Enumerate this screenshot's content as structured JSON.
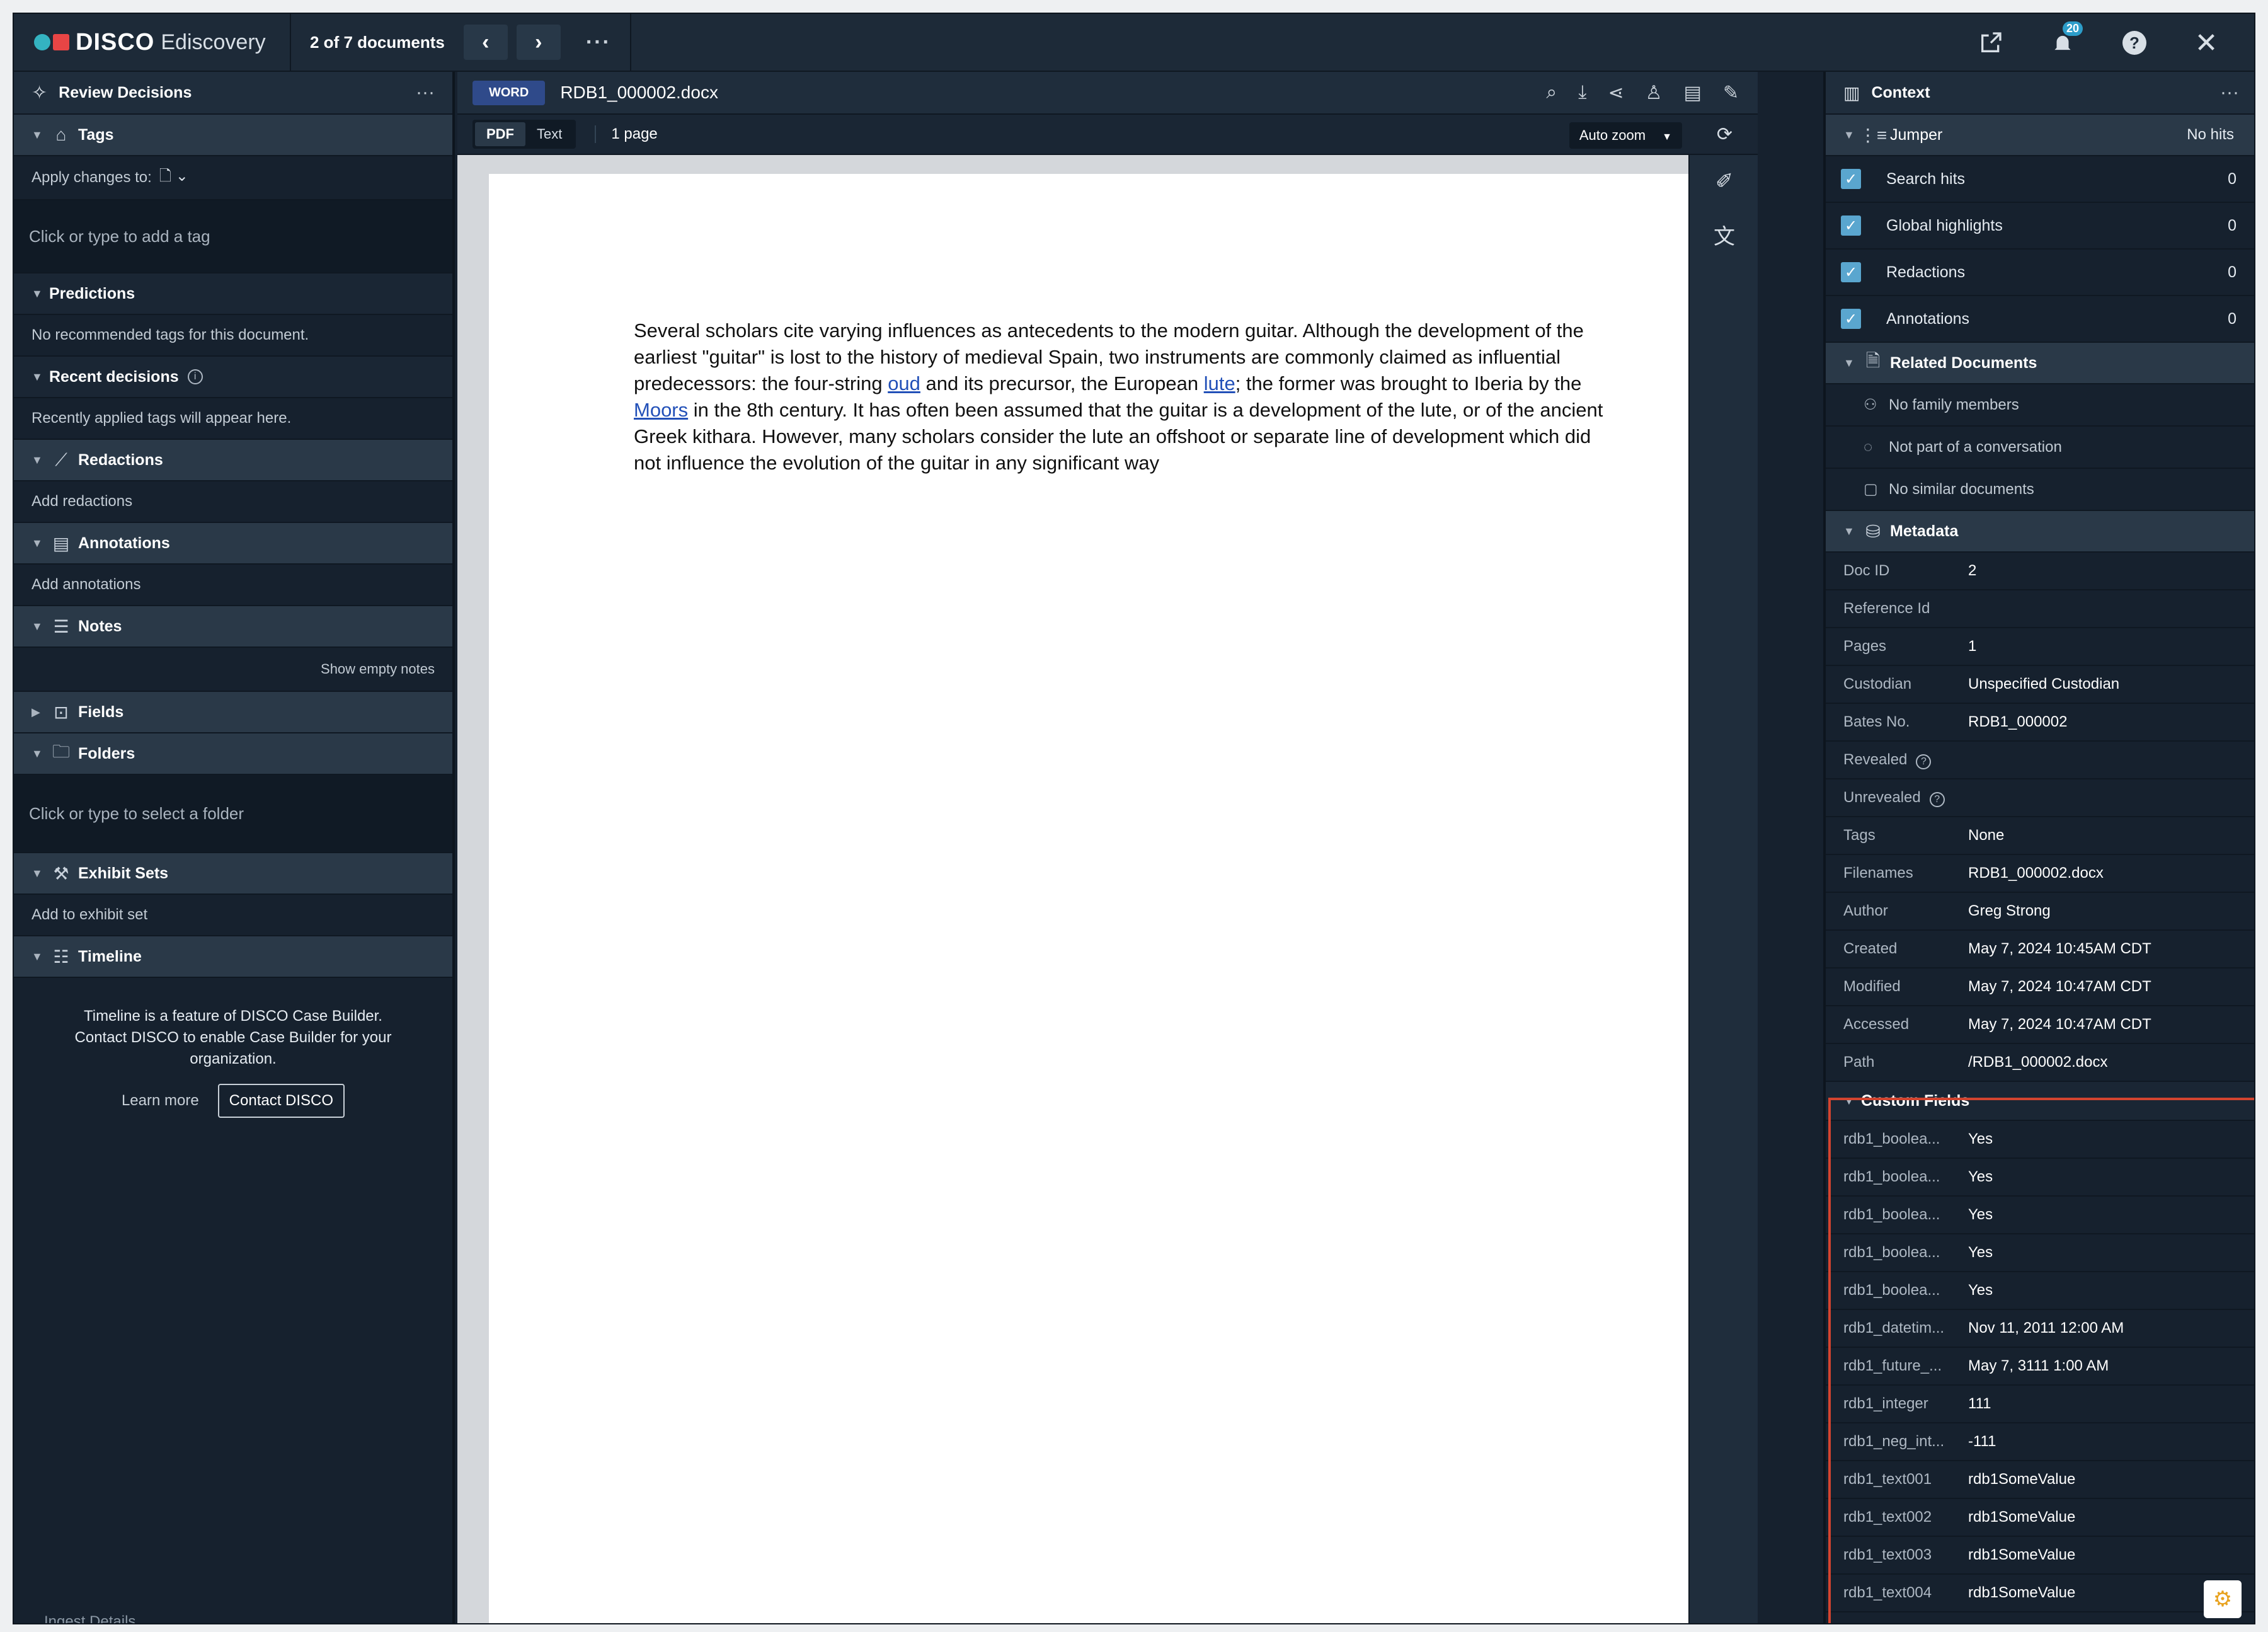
{
  "app": {
    "brand": "DISCO",
    "product": "Ediscovery",
    "doc_count": "2 of 7 documents",
    "notification_count": "20"
  },
  "left": {
    "header": "Review Decisions",
    "tags": {
      "label": "Tags",
      "apply_label": "Apply changes to:",
      "input_placeholder": "Click or type to add a tag"
    },
    "predictions": {
      "label": "Predictions",
      "text": "No recommended tags for this document."
    },
    "recent": {
      "label": "Recent decisions",
      "text": "Recently applied tags will appear here."
    },
    "redactions": {
      "label": "Redactions",
      "text": "Add redactions"
    },
    "annotations": {
      "label": "Annotations",
      "text": "Add annotations"
    },
    "notes": {
      "label": "Notes",
      "text": "Show empty notes"
    },
    "fields": {
      "label": "Fields"
    },
    "folders": {
      "label": "Folders",
      "input_placeholder": "Click or type to select a folder"
    },
    "exhibits": {
      "label": "Exhibit Sets",
      "text": "Add to exhibit set"
    },
    "timeline": {
      "label": "Timeline",
      "text": "Timeline is a feature of DISCO Case Builder. Contact DISCO to enable Case Builder for your organization.",
      "learn_more": "Learn more",
      "contact": "Contact DISCO"
    },
    "footer_text": "Ingest Details"
  },
  "viewer": {
    "badge": "WORD",
    "filename": "RDB1_000002.docx",
    "mode_pdf": "PDF",
    "mode_text": "Text",
    "page_count": "1 page",
    "zoom": "Auto zoom",
    "text_a": "Several scholars cite varying influences as antecedents to the modern guitar. Although the development of the earliest \"guitar\" is lost to the history of medieval Spain, two instruments are commonly claimed as influential predecessors: the four-string ",
    "link_oud": "oud",
    "text_b": " and its precursor, the European ",
    "link_lute": "lute",
    "text_c": "; the former was brought to Iberia by the ",
    "link_moors": "Moors",
    "text_d": " in the 8th century. It has often been assumed that the guitar is a development of the lute, or of the ancient Greek kithara. However, many scholars consider the lute an offshoot or separate line of development which did not influence the evolution of the guitar in any significant way"
  },
  "right": {
    "header": "Context",
    "jumper": {
      "label": "Jumper",
      "status": "No hits",
      "items": [
        {
          "label": "Search hits",
          "value": "0"
        },
        {
          "label": "Global highlights",
          "value": "0"
        },
        {
          "label": "Redactions",
          "value": "0"
        },
        {
          "label": "Annotations",
          "value": "0"
        }
      ]
    },
    "related": {
      "label": "Related Documents",
      "items": [
        "No family members",
        "Not part of a conversation",
        "No similar documents"
      ]
    },
    "metadata": {
      "label": "Metadata",
      "rows": [
        {
          "key": "Doc ID",
          "value": "2"
        },
        {
          "key": "Reference Id",
          "value": ""
        },
        {
          "key": "Pages",
          "value": "1"
        },
        {
          "key": "Custodian",
          "value": "Unspecified Custodian"
        },
        {
          "key": "Bates No.",
          "value": "RDB1_000002"
        },
        {
          "key": "Revealed",
          "value": ""
        },
        {
          "key": "Unrevealed",
          "value": ""
        },
        {
          "key": "Tags",
          "value": "None"
        },
        {
          "key": "Filenames",
          "value": "RDB1_000002.docx"
        },
        {
          "key": "Author",
          "value": "Greg Strong"
        },
        {
          "key": "Created",
          "value": "May 7, 2024 10:45AM CDT"
        },
        {
          "key": "Modified",
          "value": "May 7, 2024 10:47AM CDT"
        },
        {
          "key": "Accessed",
          "value": "May 7, 2024 10:47AM CDT"
        },
        {
          "key": "Path",
          "value": "/RDB1_000002.docx"
        }
      ]
    },
    "custom": {
      "label": "Custom Fields",
      "rows": [
        {
          "key": "rdb1_boolea...",
          "value": "Yes"
        },
        {
          "key": "rdb1_boolea...",
          "value": "Yes"
        },
        {
          "key": "rdb1_boolea...",
          "value": "Yes"
        },
        {
          "key": "rdb1_boolea...",
          "value": "Yes"
        },
        {
          "key": "rdb1_boolea...",
          "value": "Yes"
        },
        {
          "key": "rdb1_datetim...",
          "value": "Nov 11, 2011 12:00 AM"
        },
        {
          "key": "rdb1_future_...",
          "value": "May 7, 3111 1:00 AM"
        },
        {
          "key": "rdb1_integer",
          "value": "111"
        },
        {
          "key": "rdb1_neg_int...",
          "value": "-111"
        },
        {
          "key": "rdb1_text001",
          "value": "rdb1SomeValue"
        },
        {
          "key": "rdb1_text002",
          "value": "rdb1SomeValue"
        },
        {
          "key": "rdb1_text003",
          "value": "rdb1SomeValue"
        },
        {
          "key": "rdb1_text004",
          "value": "rdb1SomeValue"
        }
      ]
    }
  },
  "colors": {
    "accent": "#5aa6cf",
    "highlight_border": "#d3442f",
    "link": "#2250b8"
  }
}
